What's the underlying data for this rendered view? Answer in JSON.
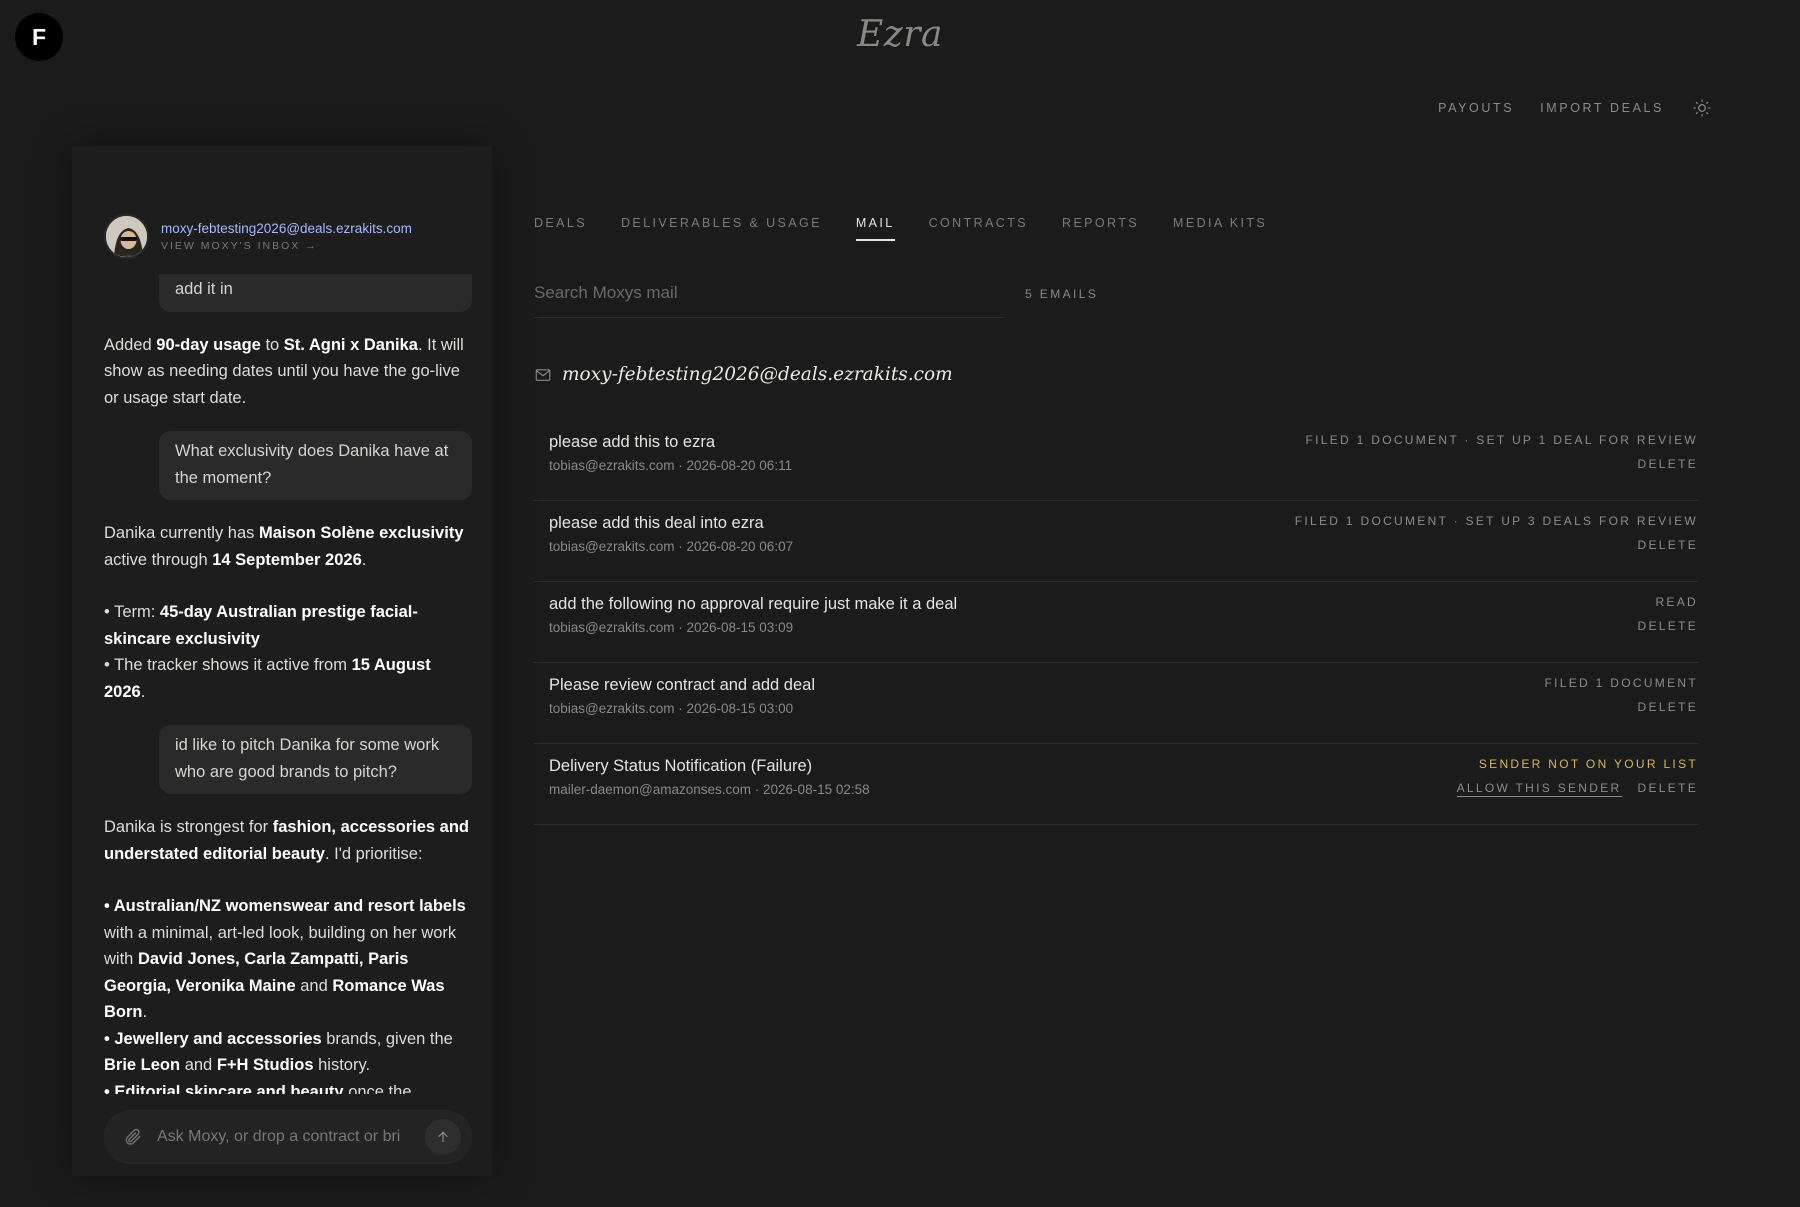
{
  "app": {
    "user_initial": "F",
    "brand": "Ezra"
  },
  "top_nav": {
    "payouts": "PAYOUTS",
    "import_deals": "IMPORT DEALS"
  },
  "chat": {
    "inbox_email": "moxy-febtesting2026@deals.ezrakits.com",
    "inbox_link": "VIEW MOXY'S INBOX →",
    "composer_placeholder": "Ask Moxy, or drop a contract or bri",
    "bubble_1": "add it in",
    "reply_1": {
      "t1": "Added ",
      "b1": "90-day usage",
      "t2": " to ",
      "b2": "St. Agni x Danika",
      "t3": ". It will show as needing dates until you have the go-live or usage start date."
    },
    "bubble_2": "What exclusivity does Danika have at the moment?",
    "reply_2": {
      "t1": "Danika currently has ",
      "b1": "Maison Solène exclusivity",
      "t2": " active through ",
      "b2": "14 September 2026",
      "t3": ".",
      "l1_pre": "• Term: ",
      "l1_b": "45-day Australian prestige facial-skincare exclusivity",
      "l2_pre": "• The tracker shows it active from ",
      "l2_b": "15 August 2026",
      "l2_post": "."
    },
    "bubble_3": "id like to pitch Danika for some work who are good brands to pitch?",
    "reply_3": {
      "t1": "Danika is strongest for ",
      "b1": "fashion, accessories and understated editorial beauty",
      "t2": ". I'd prioritise:",
      "i1_b": "• Australian/NZ womenswear and resort labels",
      "i1_t": " with a minimal, art-led look, building on her work with ",
      "i1_b2": "David Jones, Carla Zampatti, Paris Georgia, Veronika Maine",
      "i1_t2": " and ",
      "i1_b3": "Romance Was Born",
      "i1_t3": ".",
      "i2_b": "• Jewellery and accessories",
      "i2_t": " brands, given the ",
      "i2_b2": "Brie Leon",
      "i2_t2": " and ",
      "i2_b3": "F+H Studios",
      "i2_t3": " history.",
      "i3_b": "• Editorial skincare and beauty",
      "i3_t": " once the"
    }
  },
  "tabs": [
    "DEALS",
    "DELIVERABLES & USAGE",
    "MAIL",
    "CONTRACTS",
    "REPORTS",
    "MEDIA KITS"
  ],
  "active_tab": "MAIL",
  "mail": {
    "search_placeholder": "Search Moxys mail",
    "count": "5 EMAILS",
    "mailbox": "moxy-febtesting2026@deals.ezrakits.com",
    "emails": [
      {
        "subject": "please add this to ezra",
        "meta": "tobias@ezrakits.com · 2026-08-20 06:11",
        "status": "FILED 1 DOCUMENT · SET UP 1 DEAL FOR REVIEW",
        "delete": "DELETE"
      },
      {
        "subject": "please add this deal into ezra",
        "meta": "tobias@ezrakits.com · 2026-08-20 06:07",
        "status": "FILED 1 DOCUMENT · SET UP 3 DEALS FOR REVIEW",
        "delete": "DELETE"
      },
      {
        "subject": "add the following no approval require just make it a deal",
        "meta": "tobias@ezrakits.com · 2026-08-15 03:09",
        "status": "READ",
        "delete": "DELETE"
      },
      {
        "subject": "Please review contract and add deal",
        "meta": "tobias@ezrakits.com · 2026-08-15 03:00",
        "status": "FILED 1 DOCUMENT",
        "delete": "DELETE"
      },
      {
        "subject": "Delivery Status Notification (Failure)",
        "meta": "mailer-daemon@amazonses.com · 2026-08-15 02:58",
        "status": "SENDER NOT ON YOUR LIST",
        "allow": "ALLOW THIS SENDER",
        "delete": "DELETE"
      }
    ]
  },
  "colors": {
    "accent_warning": "#d8b461",
    "link_blue": "#a7b7ff",
    "background": "#1b1b1b"
  }
}
